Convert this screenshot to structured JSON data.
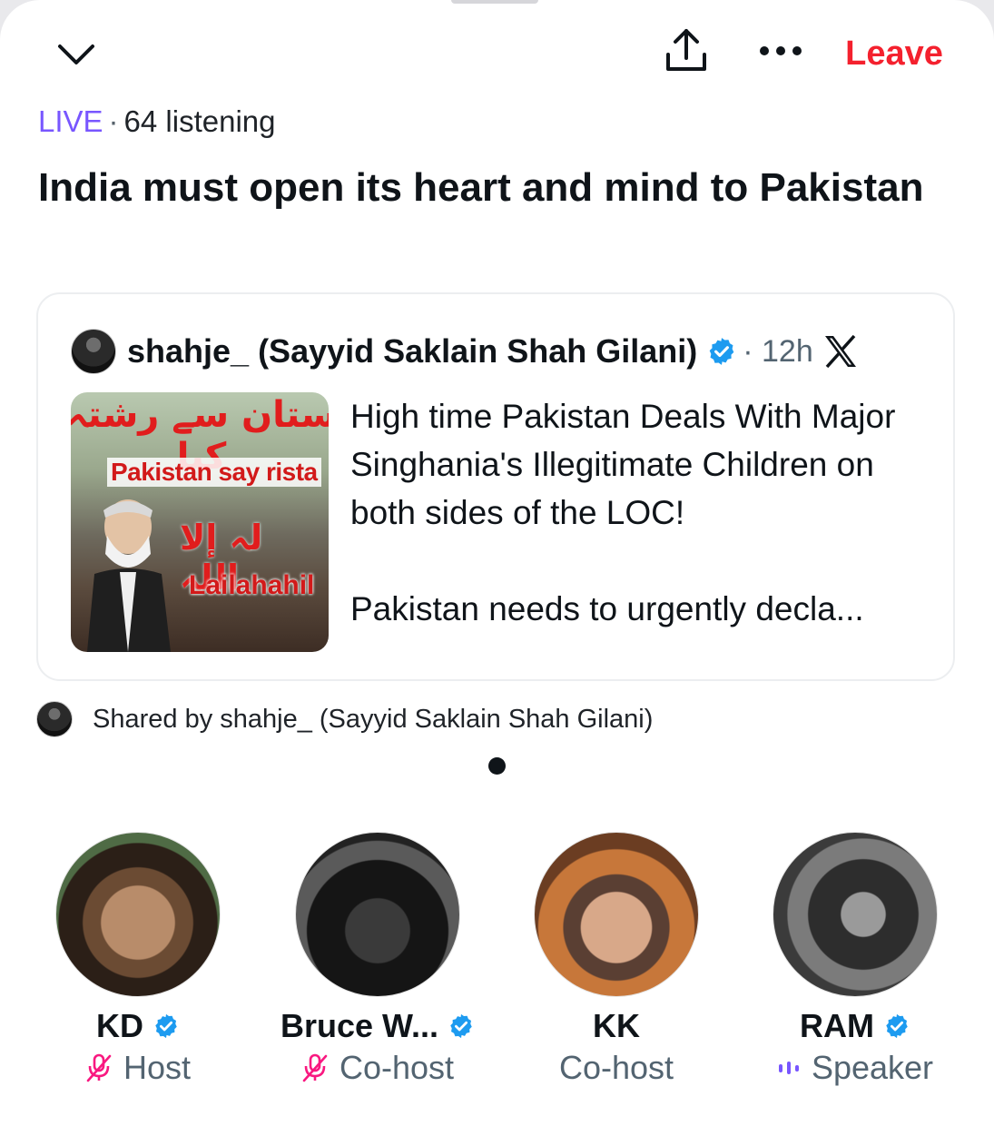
{
  "header": {
    "leave_label": "Leave"
  },
  "space": {
    "live_label": "LIVE",
    "separator": "·",
    "listening": "64 listening",
    "title": "India must open its heart and mind to Pakistan"
  },
  "tweet": {
    "author": "shahje_ (Sayyid Saklain Shah Gilani)",
    "time_separator": "·",
    "time_ago": "12h",
    "image_text": {
      "urdu_top": "ستان سے رشتہ کیا",
      "caption": "Pakistan say rista",
      "urdu_bottom": "لہ إلا اللہ",
      "latin_bottom": "Lailahahil"
    },
    "text_line1": "High time Pakistan Deals With Major Singhania's Illegitimate Children on both sides of the LOC!",
    "text_line2": "Pakistan needs to urgently decla..."
  },
  "shared_by": "Shared by shahje_ (Sayyid Saklain Shah Gilani)",
  "participants": [
    {
      "name": "KD",
      "role": "Host",
      "verified": true,
      "role_icon": "mic-muted-icon"
    },
    {
      "name": "Bruce W...",
      "role": "Co-host",
      "verified": true,
      "role_icon": "mic-muted-icon"
    },
    {
      "name": "KK",
      "role": "Co-host",
      "verified": false,
      "role_icon": ""
    },
    {
      "name": "RAM",
      "role": "Speaker",
      "verified": true,
      "role_icon": "speaking-bars-icon"
    }
  ],
  "colors": {
    "live": "#7856ff",
    "leave": "#f4212e",
    "verified": "#1d9bf0",
    "muted_mic": "#f91880"
  }
}
